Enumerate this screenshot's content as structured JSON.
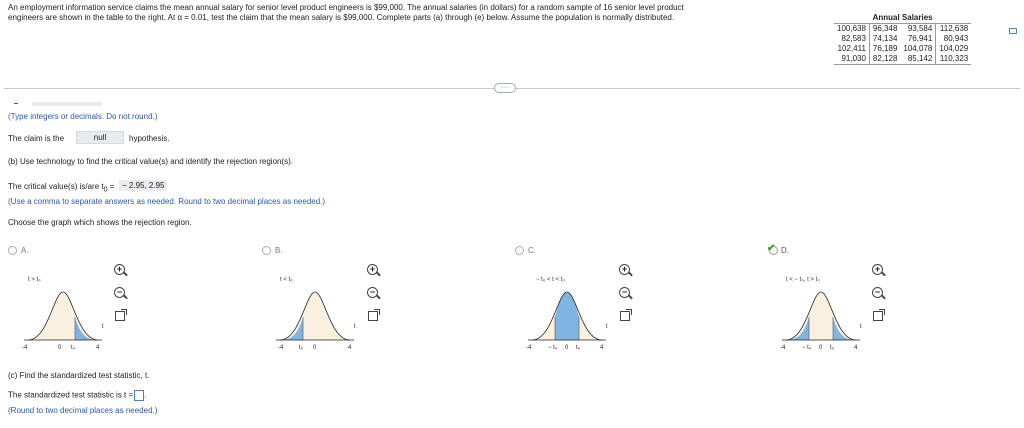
{
  "problem": {
    "line1": "An employment information service claims the mean annual salary for senior level product engineers is $99,000. The annual salaries (in dollars) for a random sample of 16 senior level product",
    "line2": "engineers are shown in the table to the right. At α = 0.01, test the claim that the mean salary is $99,000. Complete parts (a) through (e) below. Assume the population is normally distributed."
  },
  "table": {
    "title": "Annual Salaries",
    "rows": [
      [
        "100,638",
        "96,348",
        "93,584",
        "112,638"
      ],
      [
        "82,583",
        "74,134",
        "76,941",
        "80,943"
      ],
      [
        "102,411",
        "76,189",
        "104,078",
        "104,029"
      ],
      [
        "91,030",
        "82,128",
        "85,142",
        "110,323"
      ]
    ]
  },
  "more_button": "···",
  "part_a": {
    "note": "(Type integers or decimals. Do not round.)",
    "claim_prefix": "The claim is the",
    "claim_value": "null",
    "claim_suffix": "hypothesis."
  },
  "part_b": {
    "heading": "(b) Use technology to find the critical value(s) and identify the rejection region(s).",
    "crit_prefix": "The critical value(s) is/are t",
    "crit_sub": "0",
    "crit_eq": " = ",
    "crit_value": "− 2.95, 2.95",
    "crit_note": "(Use a comma to separate answers as needed. Round to two decimal places as needed.)",
    "choose": "Choose the graph which shows the rejection region."
  },
  "options": [
    {
      "letter": "A.",
      "cond": "t > t₀",
      "axis": [
        "-4",
        "0",
        "t₀",
        "4"
      ]
    },
    {
      "letter": "B.",
      "cond": "t < t₀",
      "axis": [
        "-4",
        "t₀",
        "0",
        "4"
      ]
    },
    {
      "letter": "C.",
      "cond": "− t₀ < t < t₀",
      "axis": [
        "-4",
        "− t₀",
        "0",
        "t₀",
        "4"
      ]
    },
    {
      "letter": "D.",
      "cond": "t < − t₀, t > t₀",
      "axis": [
        "-4",
        "− t₀",
        "0",
        "t₀",
        "4"
      ]
    }
  ],
  "selected_option": "D",
  "part_c": {
    "heading": "(c) Find the standardized test statistic, t.",
    "prompt": "The standardized test statistic is t =",
    "note": "(Round to two decimal places as needed.)"
  },
  "colors": {
    "curve_fill": "#faf0e0",
    "reject_fill": "#7fb5e0",
    "accent_blue": "#2a5aa8",
    "check_green": "#3a9a2f"
  }
}
